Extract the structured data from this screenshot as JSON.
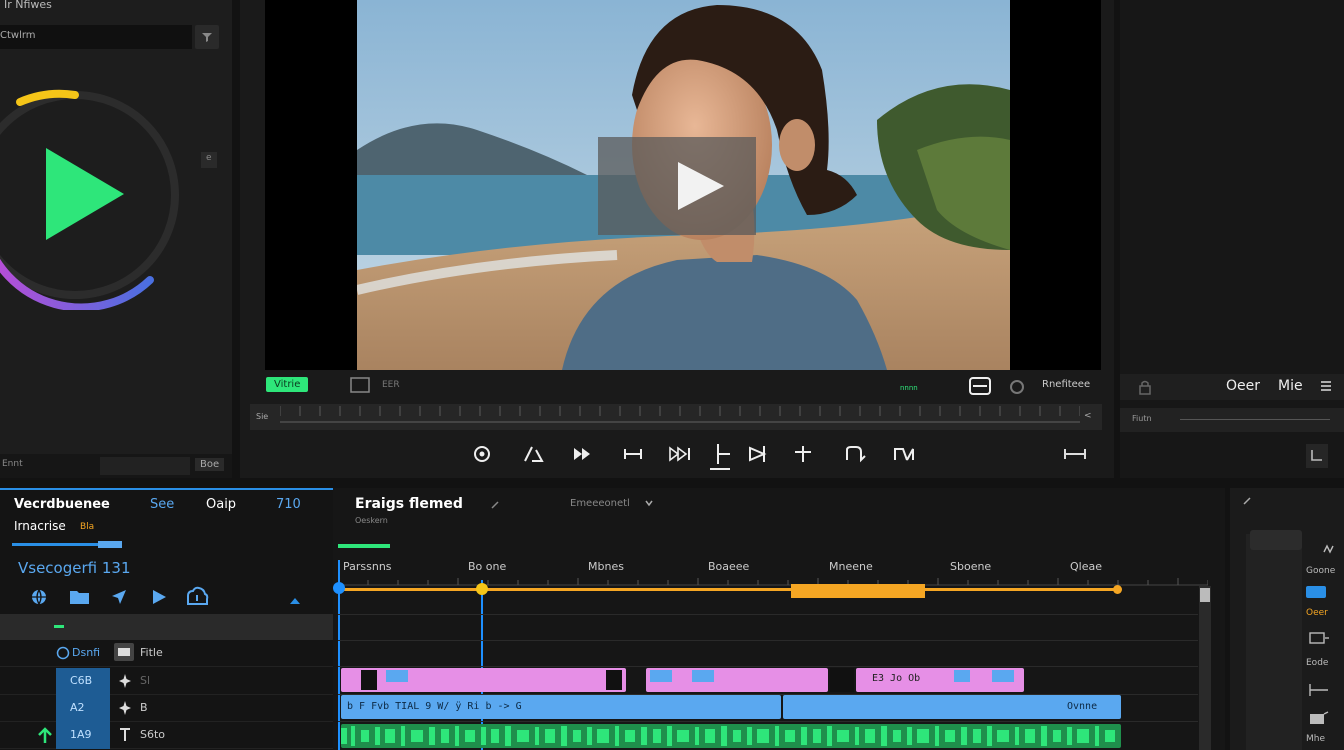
{
  "left_panel": {
    "title": "Ir Nfiwes",
    "search_placeholder": "Ctwlrm",
    "scroll_label": "e",
    "footer_left": "Ennt",
    "footer_right": "Boe"
  },
  "viewer": {
    "status_badge": "Vitrie",
    "frame_counter": "EER",
    "green_label": "nnnn",
    "fit_label": "Rnefiteee",
    "ruler_left": "Sie",
    "ruler_right": "<",
    "transport": [
      "record-icon",
      "slip-icon",
      "step-forward-icon",
      "trim-icon",
      "jump-icon",
      "mark-in-icon",
      "mark-out-icon",
      "split-icon",
      "loop-icon",
      "ripple-icon",
      "fit-timeline-icon"
    ]
  },
  "right_panel": {
    "title": "Oeer",
    "subtitle": "Mie",
    "ruler_label": "Fiutn"
  },
  "bottom_left": {
    "tabs": [
      "Vecrdbuenee",
      "See",
      "Oaip",
      "710"
    ],
    "subtitle": "Irnacrise",
    "subtitle_badge": "Bla",
    "sequence_name": "Vsecogerfi 131",
    "tracks": [
      {
        "label": "Dsnfi",
        "extra": "Fitle",
        "icon": "film-icon"
      },
      {
        "label": "C6B",
        "extra": "Sl",
        "icon": "star-icon"
      },
      {
        "label": "A2",
        "extra": "B",
        "icon": "star-icon"
      },
      {
        "label": "1A9",
        "extra": "S6to",
        "icon": "text-icon"
      }
    ]
  },
  "timeline": {
    "title": "Eraigs flemed",
    "subtitle": "Oeskern",
    "dropdown": "Emeeeonetl",
    "timecodes": [
      "Parssnns",
      "Bo one",
      "Mbnes",
      "Boaeee",
      "Mneene",
      "Sboene",
      "Qleae"
    ],
    "v1_label": "E3 Jo Ob",
    "a1_label": "b F Fvb  TIAL 9  W/ ÿ  Ri  b -> G",
    "a1_end": "Ovnne"
  },
  "tools_right": {
    "items": [
      "Goone",
      "Oeer",
      "Eode",
      "Mhe"
    ]
  },
  "colors": {
    "accent_green": "#2ee67a",
    "accent_blue": "#2a8fe6",
    "playhead": "#1e90ff",
    "orange": "#f5a623",
    "clip_pink": "#e68fe6",
    "clip_blue": "#5aa8f0",
    "audio_green": "#2ee67a"
  }
}
